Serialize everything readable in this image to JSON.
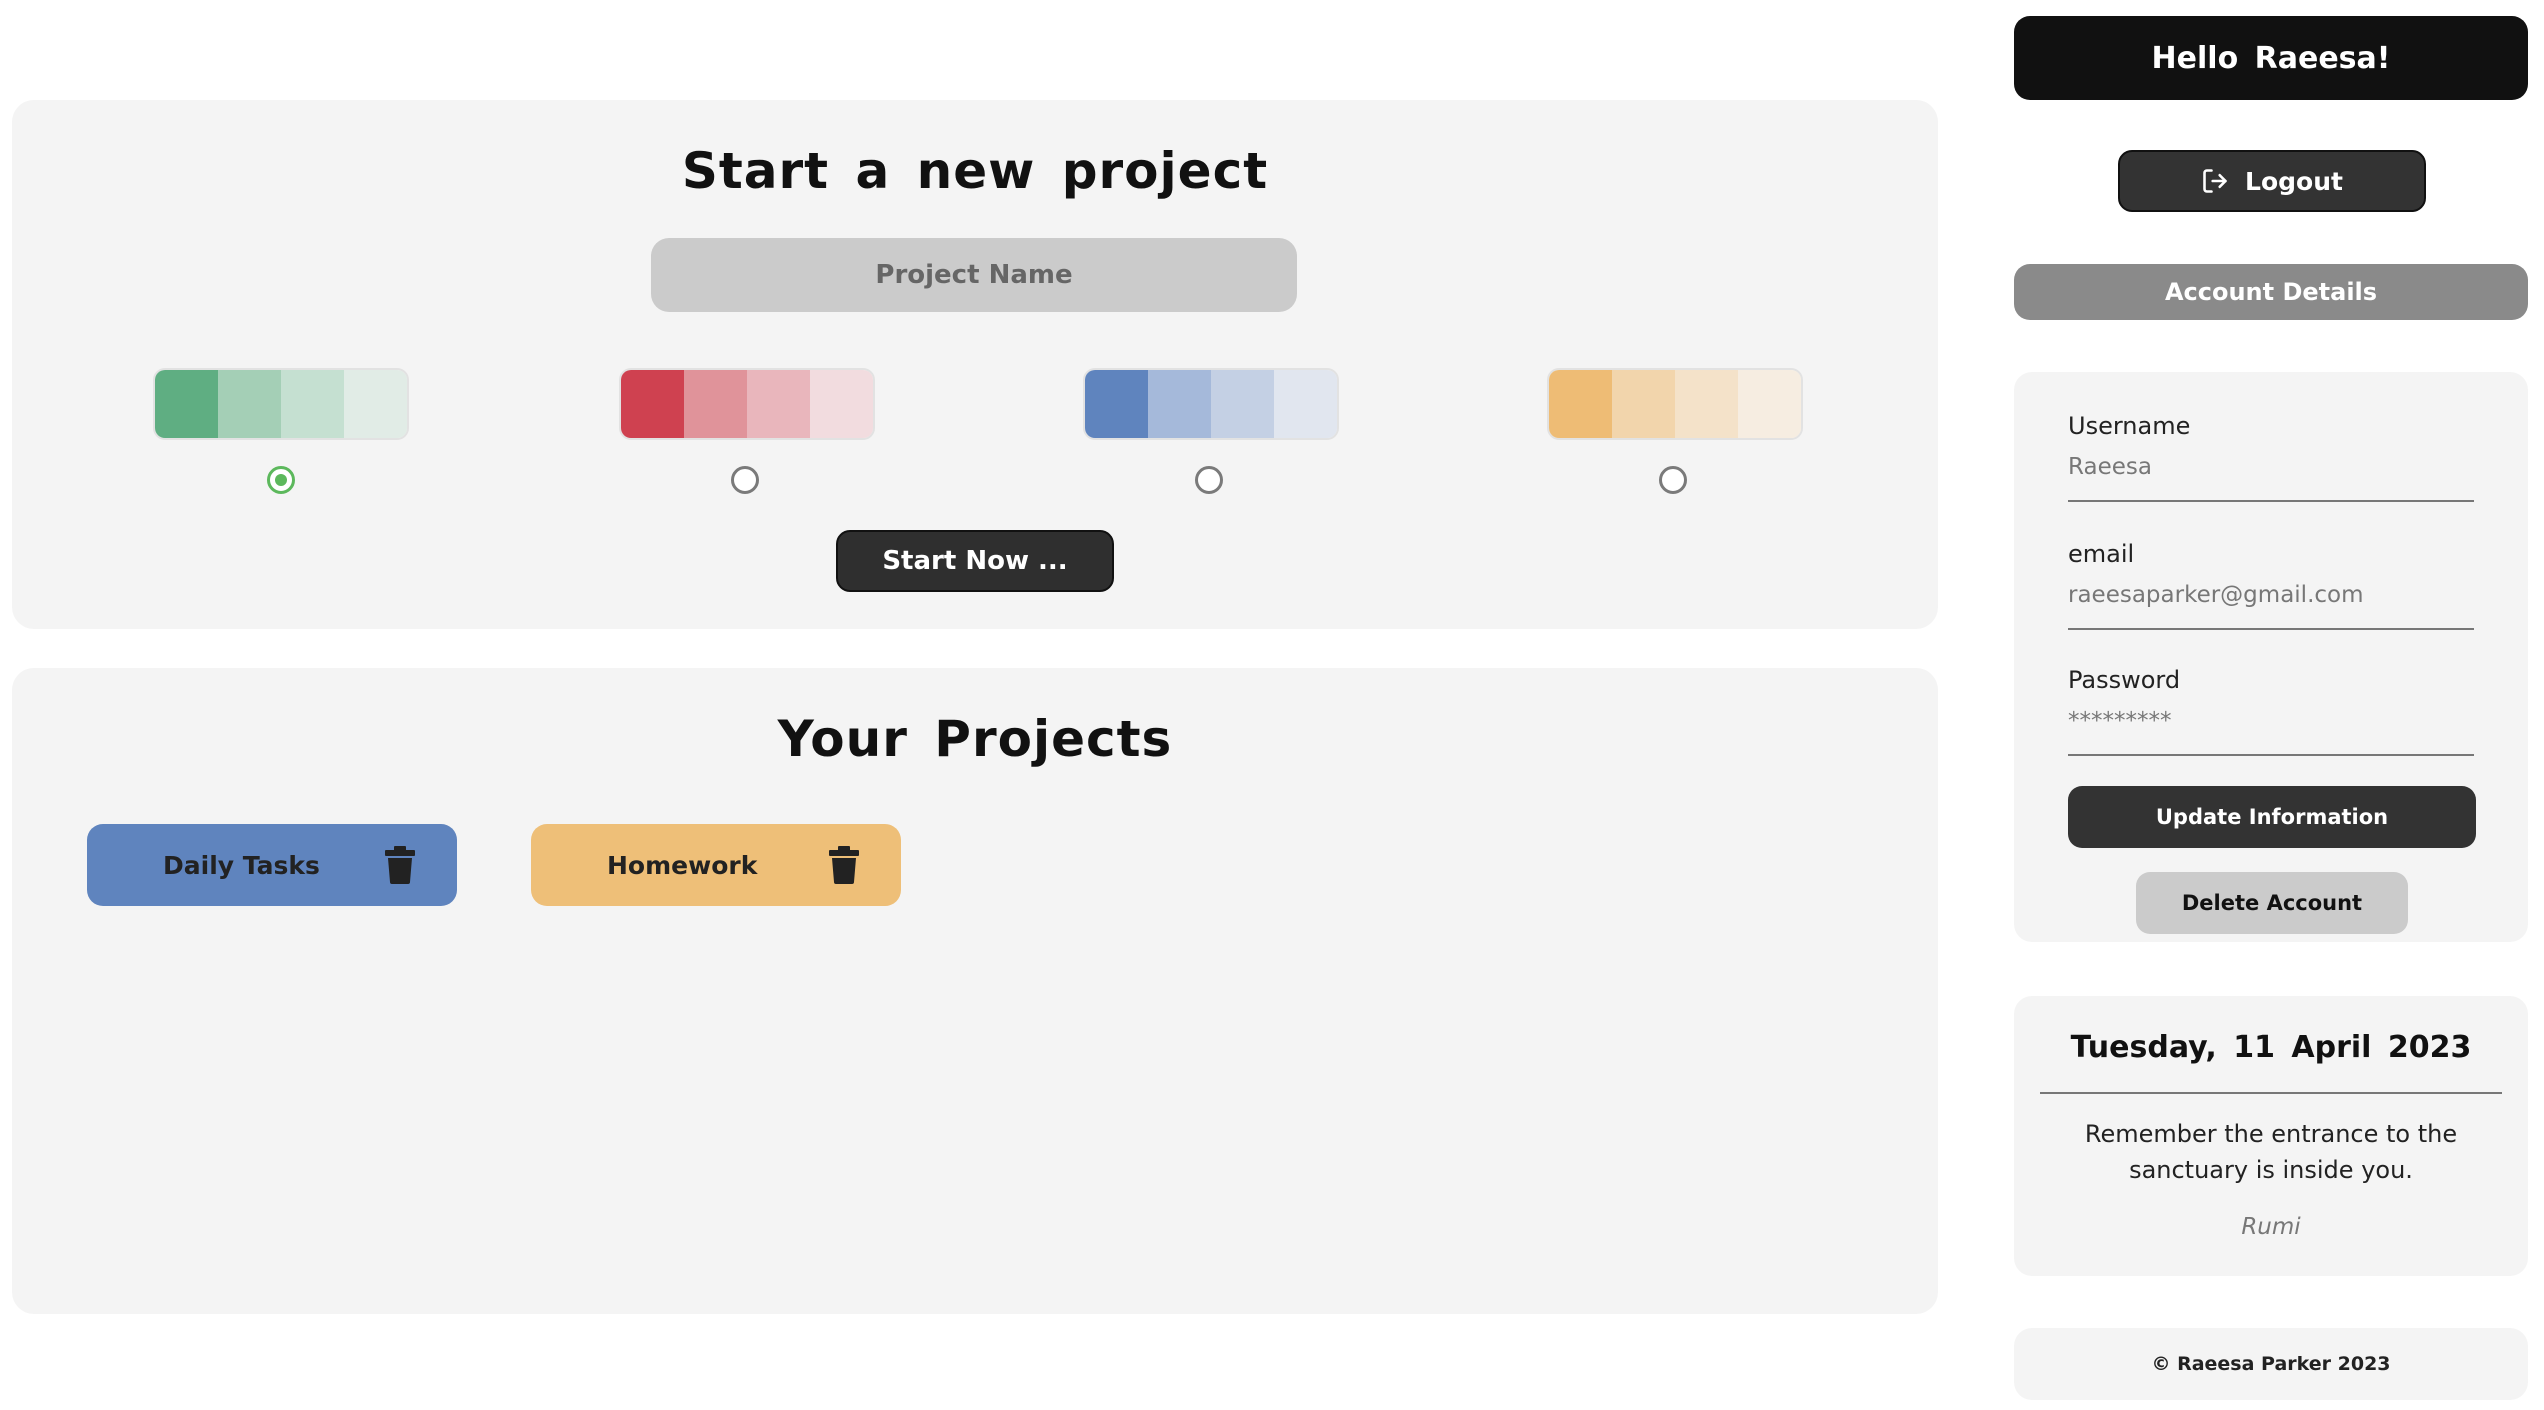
{
  "new_project": {
    "title": "Start  a  new  project",
    "name_placeholder": "Project Name",
    "name_value": "",
    "palettes": [
      {
        "name": "green",
        "colors": [
          "#5fae82",
          "#a4cfb6",
          "#c5e0d1",
          "#e1ece6"
        ],
        "selected": true
      },
      {
        "name": "red",
        "colors": [
          "#cf4150",
          "#e0939a",
          "#e9b6bc",
          "#f2dcdf"
        ],
        "selected": false
      },
      {
        "name": "blue",
        "colors": [
          "#5f84be",
          "#a5b9da",
          "#c4d0e4",
          "#e1e6ef"
        ],
        "selected": false
      },
      {
        "name": "orange",
        "colors": [
          "#eebc75",
          "#f2d5ac",
          "#f4e2c9",
          "#f6ede1"
        ],
        "selected": false
      }
    ],
    "start_label": "Start Now ...",
    "radio_selected_color": "#5cb85c"
  },
  "your_projects": {
    "title": "Your  Projects",
    "items": [
      {
        "label": "Daily Tasks",
        "color": "#5f84be"
      },
      {
        "label": "Homework",
        "color": "#eebf78"
      }
    ],
    "delete_icon": "trash-icon"
  },
  "sidebar": {
    "greeting": "Hello  Raeesa!",
    "logout_label": "Logout",
    "logout_icon": "logout-icon",
    "account_header": "Account Details",
    "account": {
      "username_label": "Username",
      "username_value": "Raeesa",
      "email_label": "email",
      "email_value": "raeesaparker@gmail.com",
      "password_label": "Password",
      "password_value": "*********",
      "update_label": "Update Information",
      "delete_label": "Delete Account"
    },
    "quote": {
      "date": "Tuesday,  11  April  2023",
      "text": "Remember the entrance to the sanctuary is inside you.",
      "author": "Rumi"
    },
    "footer": "© Raeesa Parker 2023"
  }
}
